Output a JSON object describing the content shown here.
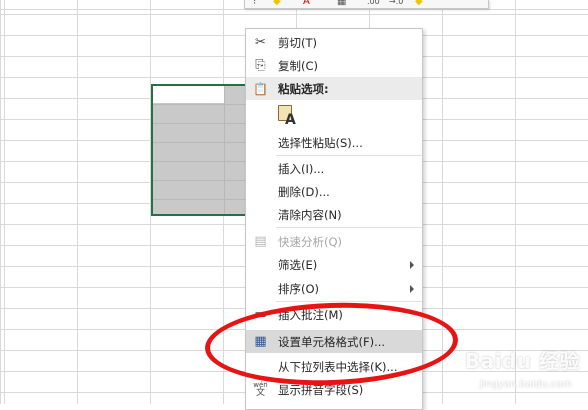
{
  "menu": {
    "items": [
      {
        "label": "剪切(T)",
        "icon": "scissors-icon",
        "glyph": "✂"
      },
      {
        "label": "复制(C)",
        "icon": "copy-icon",
        "glyph": "⎘"
      },
      {
        "label": "粘贴选项:",
        "icon": "paste-icon",
        "glyph": "📋"
      },
      {
        "label": "选择性粘贴(S)...",
        "icon": "",
        "glyph": ""
      },
      {
        "label": "插入(I)...",
        "icon": "",
        "glyph": ""
      },
      {
        "label": "删除(D)...",
        "icon": "",
        "glyph": ""
      },
      {
        "label": "清除内容(N)",
        "icon": "",
        "glyph": ""
      },
      {
        "label": "快速分析(Q)",
        "icon": "quick-analysis-icon",
        "glyph": "▤"
      },
      {
        "label": "筛选(E)",
        "icon": "",
        "glyph": ""
      },
      {
        "label": "排序(O)",
        "icon": "",
        "glyph": ""
      },
      {
        "label": "插入批注(M)",
        "icon": "insert-comment-icon",
        "glyph": "▭"
      },
      {
        "label": "设置单元格格式(F)...",
        "icon": "format-cells-icon",
        "glyph": "▦"
      },
      {
        "label": "从下拉列表中选择(K)...",
        "icon": "",
        "glyph": ""
      },
      {
        "label": "显示拼音字段(S)",
        "icon": "pinyin-icon",
        "glyph": "文"
      }
    ],
    "paste_option_letter": "A",
    "pinyin_superscript": "wén"
  },
  "toolbar": {
    "glyphs": [
      "⁝",
      "◆",
      "A",
      "▦",
      ".00",
      "→.0",
      "◆"
    ]
  },
  "watermark": {
    "text": "Baidu 经验",
    "sub": "jingyan.baidu.com"
  },
  "colors": {
    "selection_border": "#217346",
    "highlight_ring": "#e81414",
    "hover_bg": "#d9d9d9"
  }
}
